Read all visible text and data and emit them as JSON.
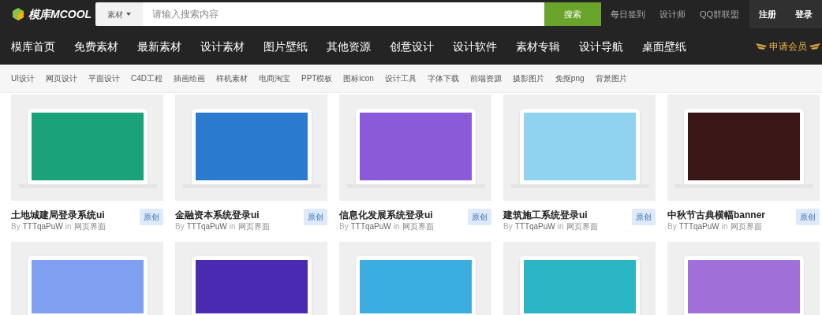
{
  "header": {
    "logo": "模库MCOOL",
    "search": {
      "scope": "素材",
      "placeholder": "请输入搜索内容",
      "button": "搜索"
    },
    "links": [
      "每日签到",
      "设计师",
      "QQ群联盟"
    ],
    "account": [
      "注册",
      "登录"
    ]
  },
  "nav": {
    "items": [
      "模库首页",
      "免费素材",
      "最新素材",
      "设计素材",
      "图片壁纸",
      "其他资源",
      "创意设计",
      "设计软件",
      "素材专辑",
      "设计导航",
      "桌面壁纸"
    ],
    "vip": "申请会员"
  },
  "categories": [
    "UI设计",
    "网页设计",
    "平面设计",
    "C4D工程",
    "插画绘画",
    "样机素材",
    "电商淘宝",
    "PPT模板",
    "图标icon",
    "设计工具",
    "字体下载",
    "前端资源",
    "摄影图片",
    "免抠png",
    "背景图片"
  ],
  "cards": [
    {
      "title": "土地城建局登录系统ui",
      "by": "By",
      "author": "TTTqaPuW",
      "in": "in",
      "category": "网页界面",
      "badge": "原创",
      "color": "#1aa37a"
    },
    {
      "title": "金融资本系统登录ui",
      "by": "By",
      "author": "TTTqaPuW",
      "in": "in",
      "category": "网页界面",
      "badge": "原创",
      "color": "#2a7bd0"
    },
    {
      "title": "信息化发展系统登录ui",
      "by": "By",
      "author": "TTTqaPuW",
      "in": "in",
      "category": "网页界面",
      "badge": "原创",
      "color": "#8a5ad8"
    },
    {
      "title": "建筑施工系统登录ui",
      "by": "By",
      "author": "TTTqaPuW",
      "in": "in",
      "category": "网页界面",
      "badge": "原创",
      "color": "#8fd3f0"
    },
    {
      "title": "中秋节古典横幅banner",
      "by": "By",
      "author": "TTTqaPuW",
      "in": "in",
      "category": "网页界面",
      "badge": "原创",
      "color": "#3a1616"
    }
  ],
  "more_cards": [
    {
      "color": "#7f9ff0"
    },
    {
      "color": "#4a2ab0"
    },
    {
      "color": "#3aaee0"
    },
    {
      "color": "#2bb5c5"
    },
    {
      "color": "#a070d8"
    }
  ]
}
